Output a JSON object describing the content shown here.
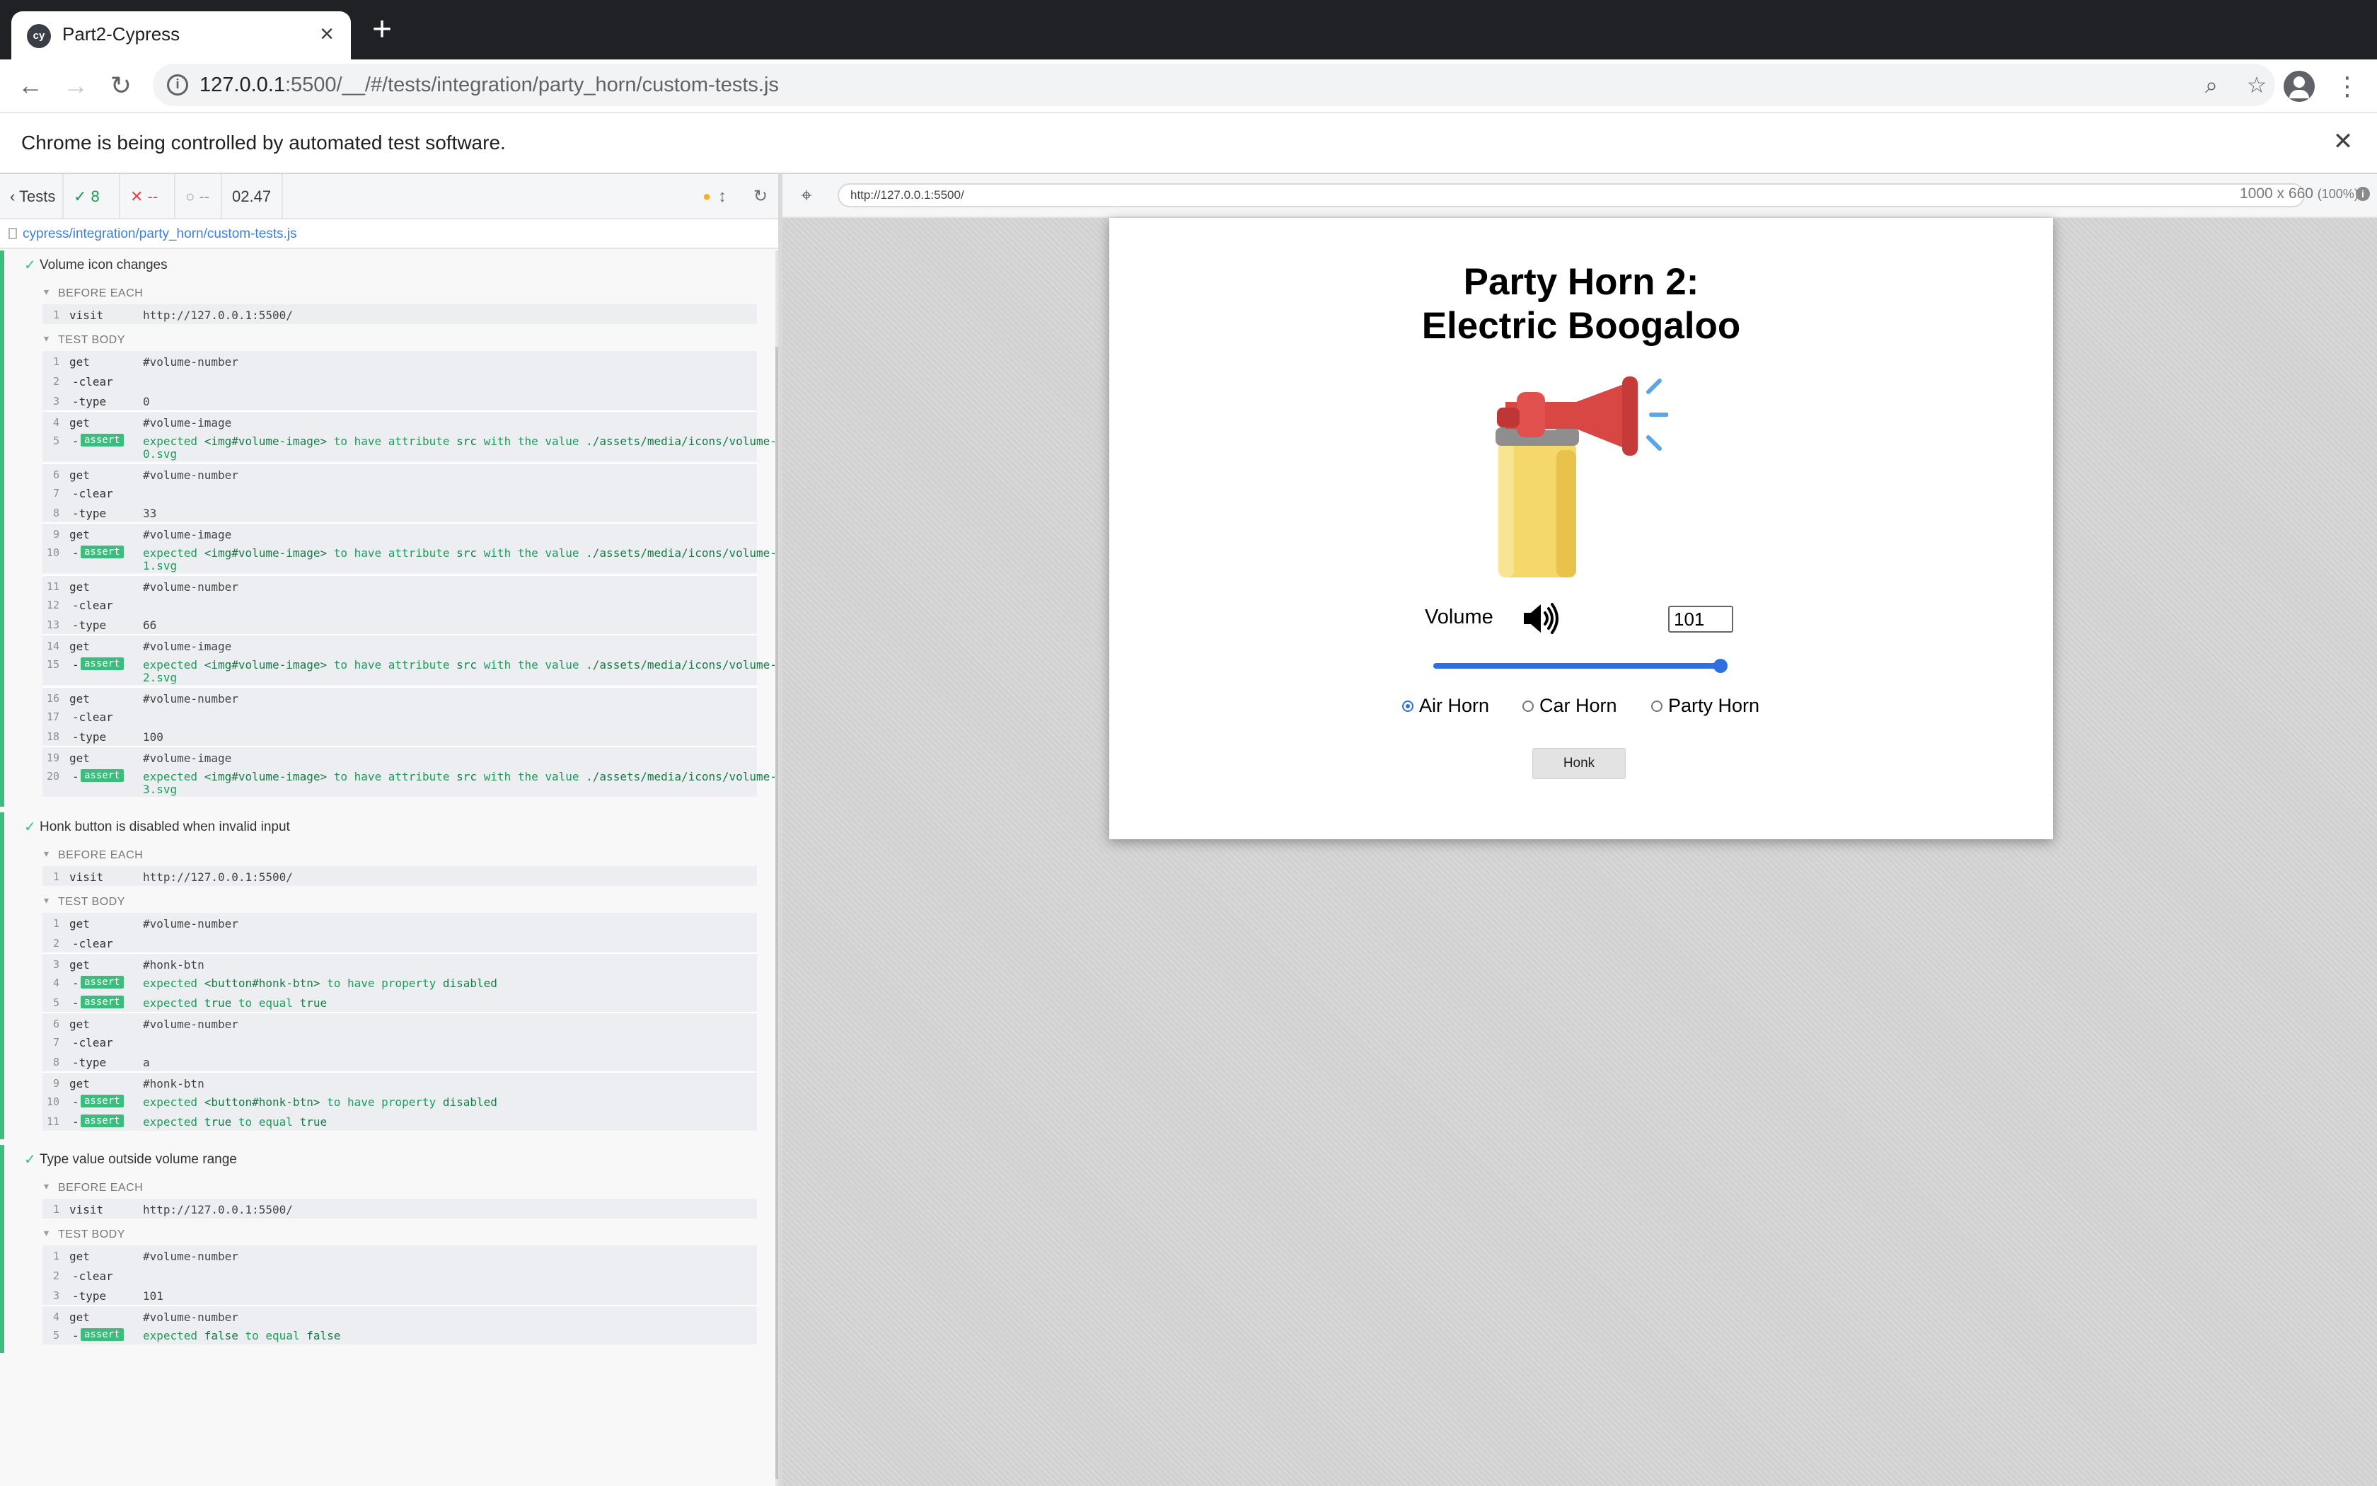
{
  "browser": {
    "tab_title": "Part2-Cypress",
    "tab_favicon": "cy",
    "new_tab": "+",
    "url_host": "127.0.0.1",
    "url_rest": ":5500/__/#/tests/integration/party_horn/custom-tests.js",
    "infobar_text": "Chrome is being controlled by automated test software."
  },
  "reporter": {
    "tests_label": "Tests",
    "passed": "8",
    "failed": "--",
    "pending": "--",
    "duration": "02.47",
    "spec_path": "cypress/integration/party_horn/custom-tests.js",
    "tests": [
      {
        "title": "Volume icon changes",
        "before_each_label": "BEFORE EACH",
        "before_each": [
          {
            "num": "1",
            "name": "visit",
            "msg": "http://127.0.0.1:5500/"
          }
        ],
        "test_body_label": "TEST BODY",
        "body": [
          {
            "num": "1",
            "name": "get",
            "msg": "#volume-number"
          },
          {
            "num": "2",
            "name": "-clear",
            "msg": ""
          },
          {
            "num": "3",
            "name": "-type",
            "msg": "0"
          },
          {
            "num": "4",
            "name": "get",
            "msg": "#volume-image"
          },
          {
            "num": "5",
            "badge": "assert",
            "pre": "expected ",
            "subject": "<img#volume-image>",
            "mid": " to have attribute ",
            "prop": "src",
            "mid2": " with the value ",
            "value": "./assets/media/icons/volume-level-",
            "wrap": "0.svg"
          },
          {
            "num": "6",
            "name": "get",
            "msg": "#volume-number"
          },
          {
            "num": "7",
            "name": "-clear",
            "msg": ""
          },
          {
            "num": "8",
            "name": "-type",
            "msg": "33"
          },
          {
            "num": "9",
            "name": "get",
            "msg": "#volume-image"
          },
          {
            "num": "10",
            "badge": "assert",
            "pre": "expected ",
            "subject": "<img#volume-image>",
            "mid": " to have attribute ",
            "prop": "src",
            "mid2": " with the value ",
            "value": "./assets/media/icons/volume-level-",
            "wrap": "1.svg"
          },
          {
            "num": "11",
            "name": "get",
            "msg": "#volume-number"
          },
          {
            "num": "12",
            "name": "-clear",
            "msg": ""
          },
          {
            "num": "13",
            "name": "-type",
            "msg": "66"
          },
          {
            "num": "14",
            "name": "get",
            "msg": "#volume-image"
          },
          {
            "num": "15",
            "badge": "assert",
            "pre": "expected ",
            "subject": "<img#volume-image>",
            "mid": " to have attribute ",
            "prop": "src",
            "mid2": " with the value ",
            "value": "./assets/media/icons/volume-level-",
            "wrap": "2.svg"
          },
          {
            "num": "16",
            "name": "get",
            "msg": "#volume-number"
          },
          {
            "num": "17",
            "name": "-clear",
            "msg": ""
          },
          {
            "num": "18",
            "name": "-type",
            "msg": "100"
          },
          {
            "num": "19",
            "name": "get",
            "msg": "#volume-image"
          },
          {
            "num": "20",
            "badge": "assert",
            "pre": "expected ",
            "subject": "<img#volume-image>",
            "mid": " to have attribute ",
            "prop": "src",
            "mid2": " with the value ",
            "value": "./assets/media/icons/volume-level-",
            "wrap": "3.svg"
          }
        ]
      },
      {
        "title": "Honk button is disabled when invalid input",
        "before_each_label": "BEFORE EACH",
        "before_each": [
          {
            "num": "1",
            "name": "visit",
            "msg": "http://127.0.0.1:5500/"
          }
        ],
        "test_body_label": "TEST BODY",
        "body": [
          {
            "num": "1",
            "name": "get",
            "msg": "#volume-number"
          },
          {
            "num": "2",
            "name": "-clear",
            "msg": ""
          },
          {
            "num": "3",
            "name": "get",
            "msg": "#honk-btn"
          },
          {
            "num": "4",
            "badge": "assert",
            "pre": "expected ",
            "subject": "<button#honk-btn>",
            "mid": " to have property ",
            "prop": "disabled"
          },
          {
            "num": "5",
            "badge": "assert",
            "pre": "expected ",
            "subject": "true",
            "mid": " to equal ",
            "prop": "true"
          },
          {
            "num": "6",
            "name": "get",
            "msg": "#volume-number"
          },
          {
            "num": "7",
            "name": "-clear",
            "msg": ""
          },
          {
            "num": "8",
            "name": "-type",
            "msg": "a"
          },
          {
            "num": "9",
            "name": "get",
            "msg": "#honk-btn"
          },
          {
            "num": "10",
            "badge": "assert",
            "pre": "expected ",
            "subject": "<button#honk-btn>",
            "mid": " to have property ",
            "prop": "disabled"
          },
          {
            "num": "11",
            "badge": "assert",
            "pre": "expected ",
            "subject": "true",
            "mid": " to equal ",
            "prop": "true"
          }
        ]
      },
      {
        "title": "Type value outside volume range",
        "before_each_label": "BEFORE EACH",
        "before_each": [
          {
            "num": "1",
            "name": "visit",
            "msg": "http://127.0.0.1:5500/"
          }
        ],
        "test_body_label": "TEST BODY",
        "body": [
          {
            "num": "1",
            "name": "get",
            "msg": "#volume-number"
          },
          {
            "num": "2",
            "name": "-clear",
            "msg": ""
          },
          {
            "num": "3",
            "name": "-type",
            "msg": "101"
          },
          {
            "num": "4",
            "name": "get",
            "msg": "#volume-number"
          },
          {
            "num": "5",
            "badge": "assert",
            "pre": "expected ",
            "subject": "false",
            "mid": " to equal ",
            "prop": "false"
          }
        ]
      }
    ]
  },
  "aut": {
    "url": "http://127.0.0.1:5500/",
    "viewport": "1000 x 660",
    "zoom": "(100%)"
  },
  "app": {
    "title_line1": "Party Horn 2:",
    "title_line2": "Electric Boogaloo",
    "volume_label": "Volume",
    "volume_value": "101",
    "slider_value": 100,
    "radios": [
      {
        "label": "Air Horn",
        "checked": true
      },
      {
        "label": "Car Horn",
        "checked": false
      },
      {
        "label": "Party Horn",
        "checked": false
      }
    ],
    "honk_label": "Honk"
  }
}
